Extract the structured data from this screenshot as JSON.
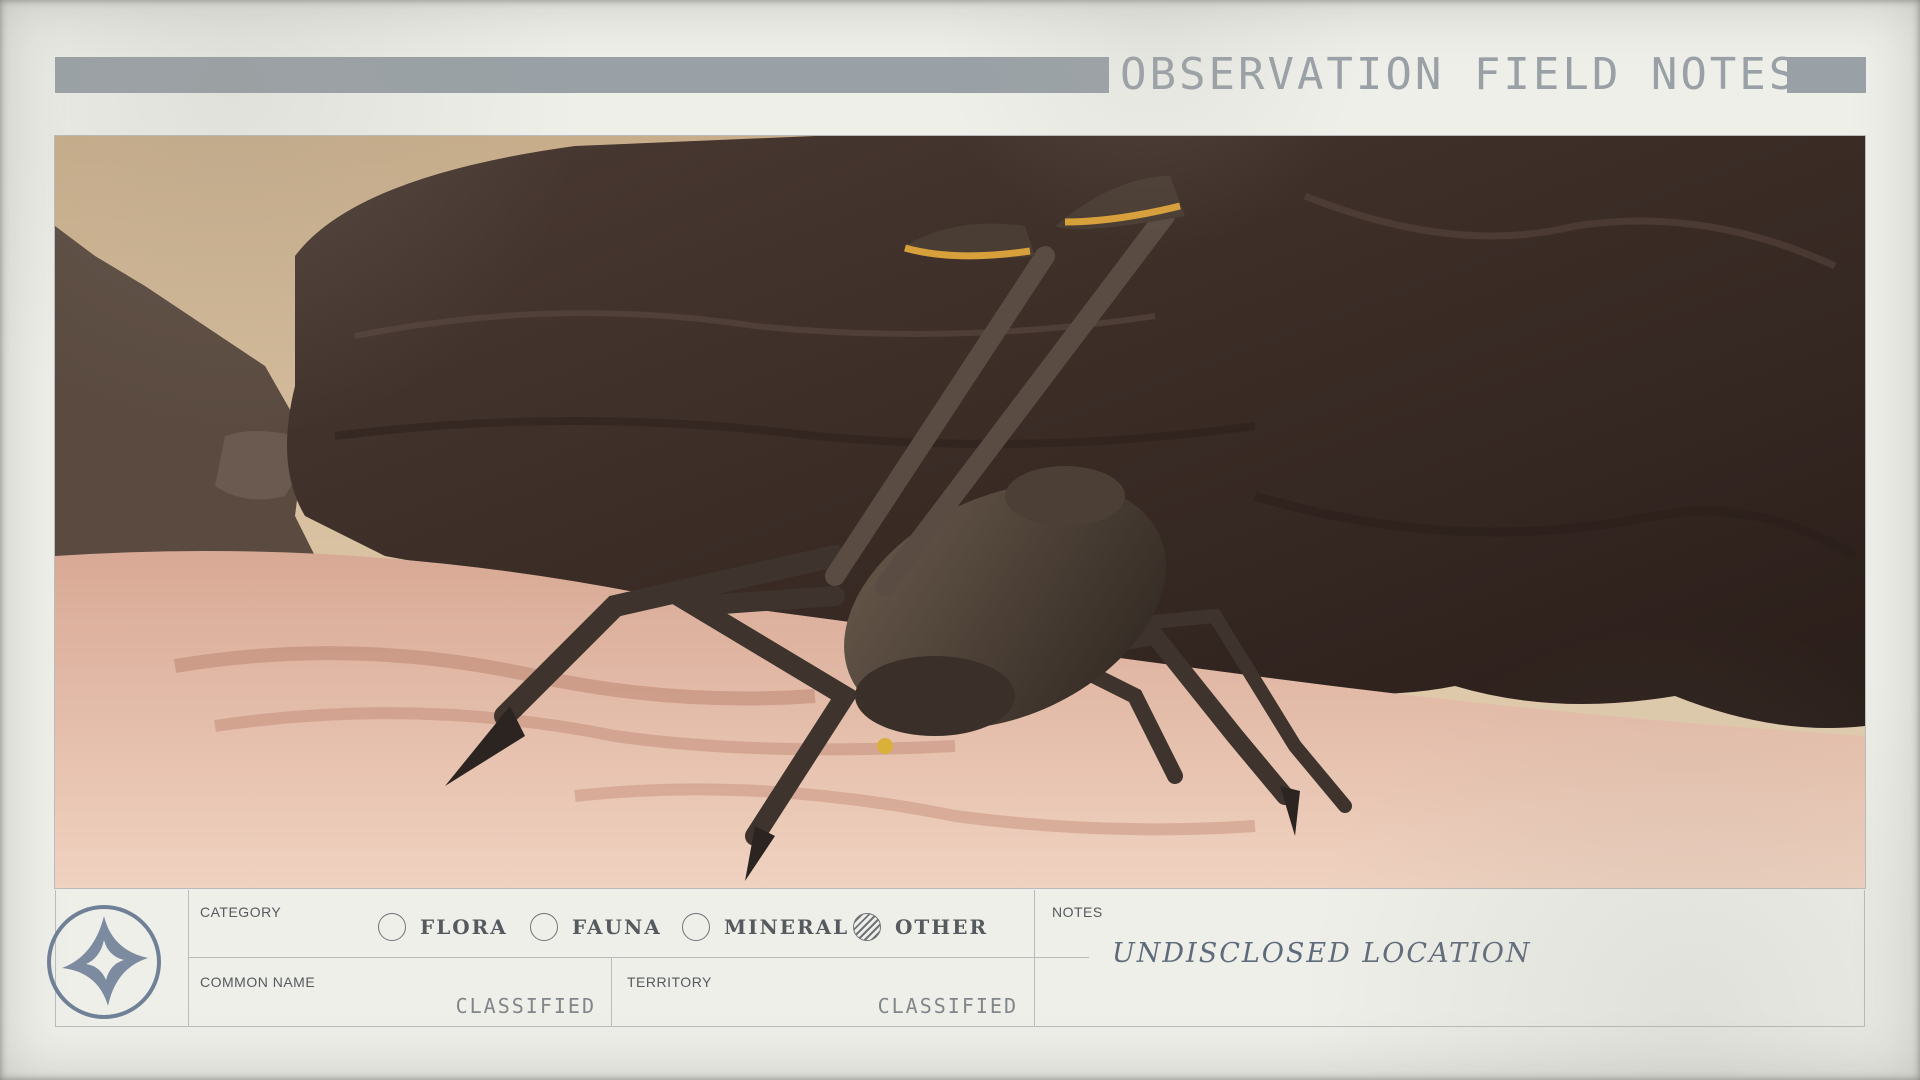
{
  "header": {
    "title": "OBSERVATION FIELD NOTES"
  },
  "photo": {
    "subject": "creature-photo"
  },
  "form": {
    "category": {
      "label": "CATEGORY",
      "options": [
        {
          "label": "FLORA",
          "checked": false
        },
        {
          "label": "FAUNA",
          "checked": false
        },
        {
          "label": "MINERAL",
          "checked": false
        },
        {
          "label": "OTHER",
          "checked": true
        }
      ]
    },
    "common_name": {
      "label": "COMMON NAME",
      "value": "CLASSIFIED"
    },
    "territory": {
      "label": "TERRITORY",
      "value": "CLASSIFIED"
    },
    "notes": {
      "label": "NOTES",
      "value": "UNDISCLOSED LOCATION"
    }
  },
  "colors": {
    "paper": "#efefea",
    "ink": "#9aa1a6",
    "text": "#555a5e",
    "handwriting": "#5e6b7a"
  }
}
